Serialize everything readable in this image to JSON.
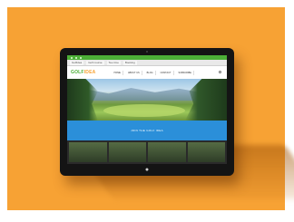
{
  "browser": {
    "tabs": [
      "Golfidea",
      "Golf course",
      "Tee time",
      "Booking"
    ]
  },
  "site": {
    "logo_main": "GOLF",
    "logo_accent": "IDEA",
    "nav": [
      "HOME",
      "ABOUT US",
      "BLOG",
      "CONTACT",
      "SUBSCRIBE"
    ]
  },
  "banner": {
    "text": "JOIN THE GOLF IDEA"
  },
  "colors": {
    "background": "#f7a234",
    "accent": "#4caf37",
    "banner": "#2b8fd9"
  }
}
